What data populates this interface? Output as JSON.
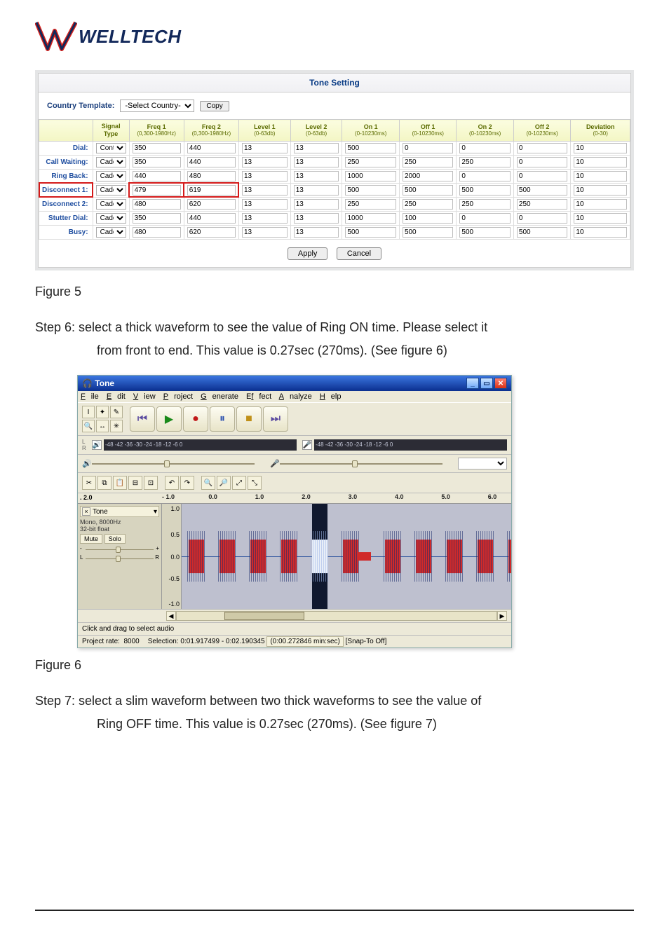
{
  "logo": {
    "text": "WELLTECH"
  },
  "panel": {
    "title": "Tone Setting",
    "countryLabel": "Country Template:",
    "countrySelect": "-Select Country-",
    "copy": "Copy",
    "headers": {
      "signal": "Signal Type",
      "freq1": "Freq 1",
      "freq1sub": "(0,300-1980Hz)",
      "freq2": "Freq 2",
      "freq2sub": "(0,300-1980Hz)",
      "lvl1": "Level 1",
      "lvl1sub": "(0-63db)",
      "lvl2": "Level 2",
      "lvl2sub": "(0-63db)",
      "on1": "On 1",
      "on1sub": "(0-10230ms)",
      "off1": "Off 1",
      "off1sub": "(0-10230ms)",
      "on2": "On 2",
      "on2sub": "(0-10230ms)",
      "off2": "Off 2",
      "off2sub": "(0-10230ms)",
      "dev": "Deviation",
      "devsub": "(0-30)"
    },
    "rows": [
      {
        "label": "Dial:",
        "sig": "Continuous",
        "f1": "350",
        "f2": "440",
        "l1": "13",
        "l2": "13",
        "on1": "500",
        "off1": "0",
        "on2": "0",
        "off2": "0",
        "dev": "10"
      },
      {
        "label": "Call Waiting:",
        "sig": "Cadence",
        "f1": "350",
        "f2": "440",
        "l1": "13",
        "l2": "13",
        "on1": "250",
        "off1": "250",
        "on2": "250",
        "off2": "0",
        "dev": "10"
      },
      {
        "label": "Ring Back:",
        "sig": "Cadence",
        "f1": "440",
        "f2": "480",
        "l1": "13",
        "l2": "13",
        "on1": "1000",
        "off1": "2000",
        "on2": "0",
        "off2": "0",
        "dev": "10"
      },
      {
        "label": "Disconnect 1:",
        "sig": "Cadence",
        "f1": "479",
        "f2": "619",
        "l1": "13",
        "l2": "13",
        "on1": "500",
        "off1": "500",
        "on2": "500",
        "off2": "500",
        "dev": "10",
        "highlight": true
      },
      {
        "label": "Disconnect 2:",
        "sig": "Cadence",
        "f1": "480",
        "f2": "620",
        "l1": "13",
        "l2": "13",
        "on1": "250",
        "off1": "250",
        "on2": "250",
        "off2": "250",
        "dev": "10"
      },
      {
        "label": "Stutter Dial:",
        "sig": "Cadence",
        "f1": "350",
        "f2": "440",
        "l1": "13",
        "l2": "13",
        "on1": "1000",
        "off1": "100",
        "on2": "0",
        "off2": "0",
        "dev": "10"
      },
      {
        "label": "Busy:",
        "sig": "Cadence",
        "f1": "480",
        "f2": "620",
        "l1": "13",
        "l2": "13",
        "on1": "500",
        "off1": "500",
        "on2": "500",
        "off2": "500",
        "dev": "10"
      }
    ],
    "apply": "Apply",
    "cancel": "Cancel"
  },
  "caption5": "Figure 5",
  "step6a": "Step 6: select a thick waveform to see the value of Ring ON time. Please select it",
  "step6b": "from front to end. This value is 0.27sec (270ms). (See figure 6)",
  "app": {
    "title": "Tone",
    "menu": [
      "File",
      "Edit",
      "View",
      "Project",
      "Generate",
      "Effect",
      "Analyze",
      "Help"
    ],
    "meterTicks": "-48  -42  -36  -30  -24  -18  -12   -6    0",
    "timeline": {
      "start": ". 2.0",
      "ticks": [
        "- 1.0",
        "0.0",
        "1.0",
        "2.0",
        "3.0",
        "4.0",
        "5.0",
        "6.0"
      ]
    },
    "track": {
      "name": "Tone",
      "l1": "Mono, 8000Hz",
      "l2": "32-bit float",
      "mute": "Mute",
      "solo": "Solo",
      "panL": "L",
      "panR": "R",
      "ylabels": [
        "1.0",
        "0.5",
        "0.0",
        "-0.5",
        "-1.0"
      ]
    },
    "status": "Click and drag to select audio",
    "info": {
      "rateLabel": "Project rate:",
      "rate": "8000",
      "sel": "Selection: 0:01.917499 - 0:02.190345 (0:00.272846 min:sec)  [Snap-To Off]"
    }
  },
  "caption6": "Figure 6",
  "step7a": "Step 7: select a slim waveform between two thick waveforms to see the value of",
  "step7b": "Ring OFF time. This value is 0.27sec (270ms). (See figure 7)"
}
